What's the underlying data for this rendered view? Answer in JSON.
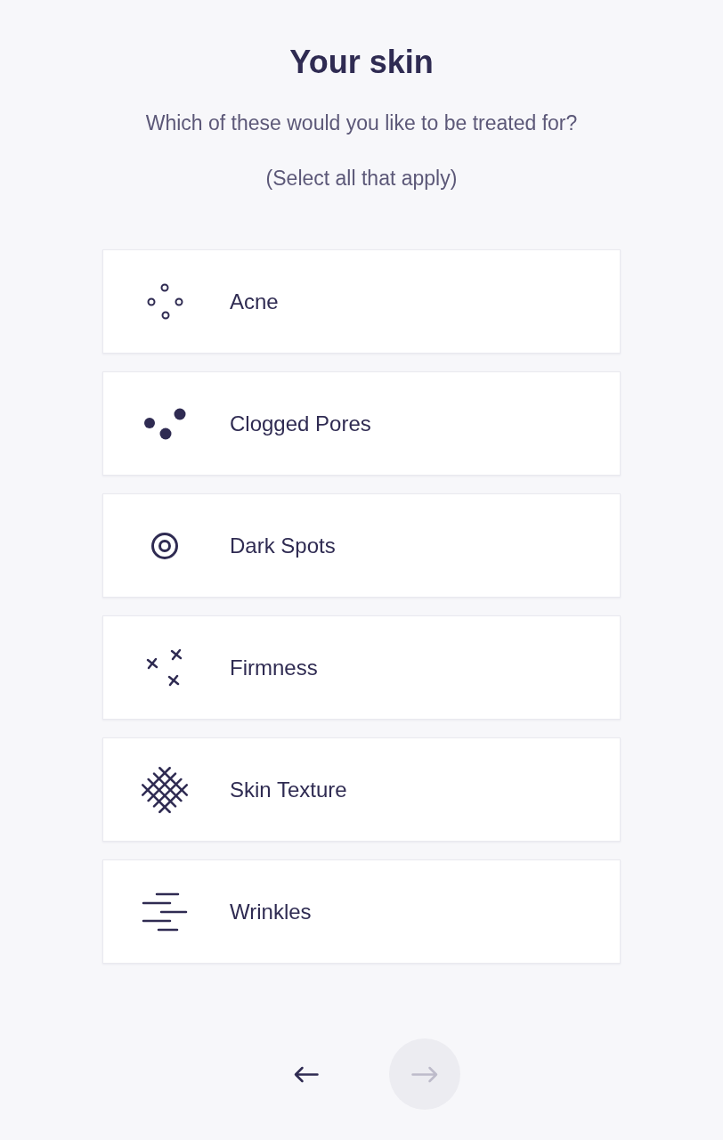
{
  "title": "Your skin",
  "question": "Which of these would you like to be treated for?",
  "hint": "(Select all that apply)",
  "options": [
    {
      "label": "Acne",
      "selected": false
    },
    {
      "label": "Clogged Pores",
      "selected": false
    },
    {
      "label": "Dark Spots",
      "selected": false
    },
    {
      "label": "Firmness",
      "selected": false
    },
    {
      "label": "Skin Texture",
      "selected": false
    },
    {
      "label": "Wrinkles",
      "selected": false
    }
  ],
  "next_button": {
    "disabled": true
  }
}
